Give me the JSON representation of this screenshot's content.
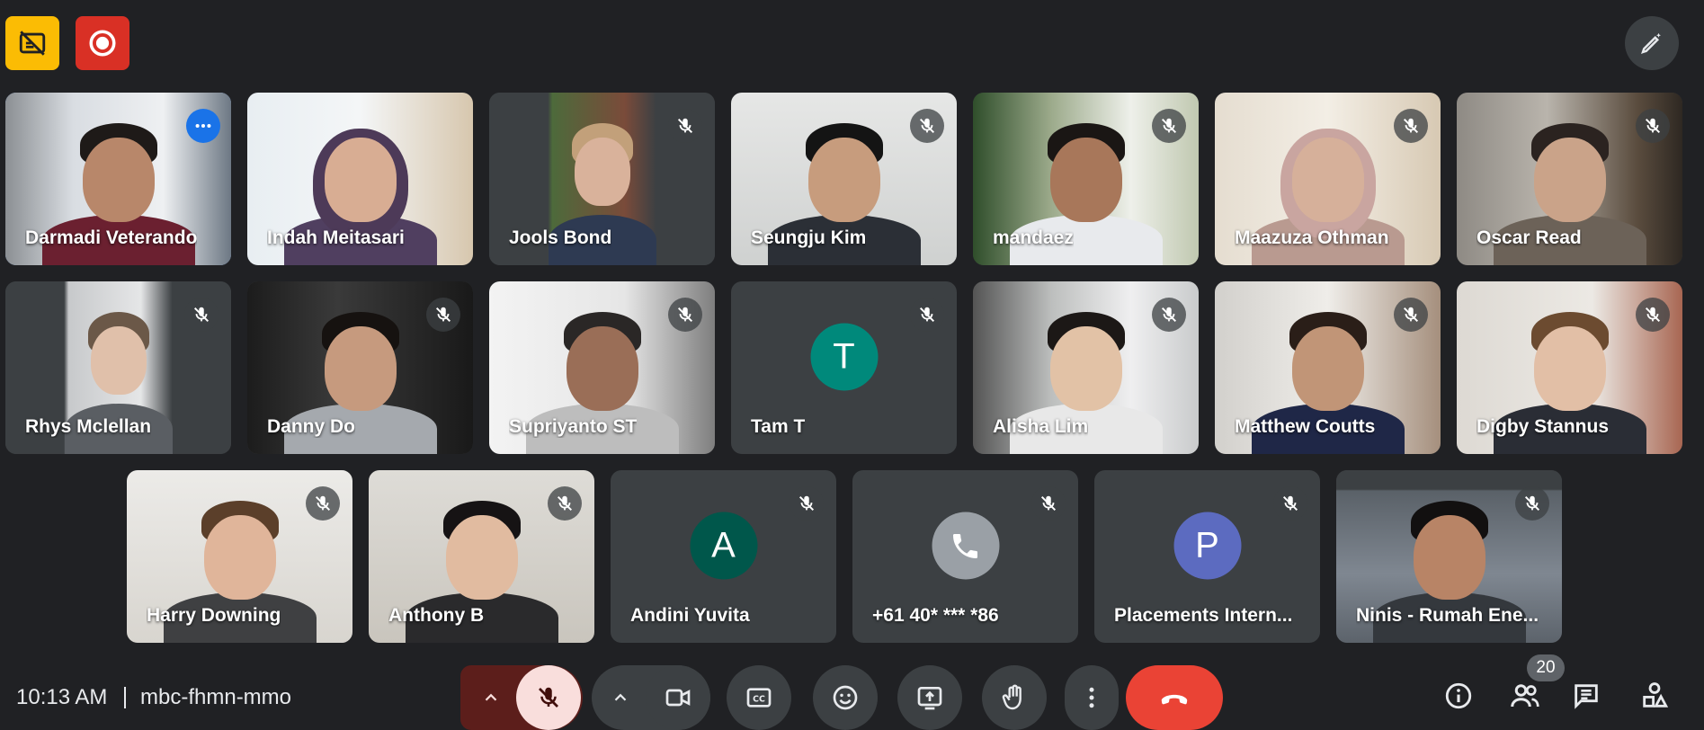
{
  "colors": {
    "background": "#202124",
    "tile": "#3c4043",
    "active_outline": "#8ab4f8",
    "end_call": "#ea4335",
    "mic_off": "#f9dedc"
  },
  "participants": [
    {
      "name": "Darmadi Veterando"
    },
    {
      "name": "Indah Meitasari"
    },
    {
      "name": "Jools Bond"
    },
    {
      "name": "Seungju Kim"
    },
    {
      "name": "mandaez"
    },
    {
      "name": "Maazuza Othman"
    },
    {
      "name": "Oscar Read"
    },
    {
      "name": "Rhys Mclellan"
    },
    {
      "name": "Danny Do"
    },
    {
      "name": "Supriyanto ST"
    },
    {
      "name": "Tam T",
      "initial": "T",
      "avatar_color": "#00897b"
    },
    {
      "name": "Alisha Lim"
    },
    {
      "name": "Matthew Coutts"
    },
    {
      "name": "Digby Stannus"
    },
    {
      "name": "Harry Downing"
    },
    {
      "name": "Anthony B"
    },
    {
      "name": "Andini Yuvita",
      "initial": "A",
      "avatar_color": "#00574b"
    },
    {
      "name": "+61 40* *** *86",
      "avatar_color": "#9aa0a6"
    },
    {
      "name": "Placements Intern...",
      "initial": "P",
      "avatar_color": "#5c6bc0"
    },
    {
      "name": "Ninis - Rumah Ene..."
    }
  ],
  "status": {
    "time": "10:13 AM",
    "meeting_code": "mbc-fhmn-mmo"
  },
  "people_count": "20",
  "icons": [
    "captions-off-icon",
    "record-icon",
    "effects-pencil-icon",
    "mic-off-icon",
    "more-dots-icon",
    "chevron-up-icon",
    "camera-icon",
    "cc-icon",
    "emoji-icon",
    "present-icon",
    "hand-icon",
    "more-vert-icon",
    "end-call-icon",
    "info-icon",
    "people-icon",
    "chat-icon",
    "activities-icon",
    "phone-icon"
  ]
}
